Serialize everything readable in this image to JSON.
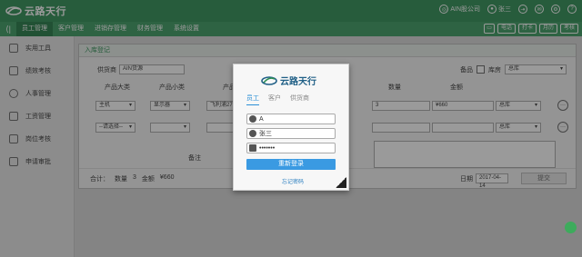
{
  "brand": {
    "name": "云路天行"
  },
  "topbar": {
    "company": "AIN股公司",
    "user": "张三"
  },
  "nav": {
    "collapse_glyph": "⟨|",
    "tabs": [
      "员工管理",
      "客户管理",
      "进销存管理",
      "财务管理",
      "系统设置"
    ],
    "tools": [
      "电话",
      "打卡",
      "月历",
      "考核"
    ]
  },
  "sidebar": {
    "items": [
      {
        "label": "实用工具"
      },
      {
        "label": "绩效考核"
      },
      {
        "label": "人事管理"
      },
      {
        "label": "工资管理"
      },
      {
        "label": "岗位考核"
      },
      {
        "label": "申请审批"
      }
    ]
  },
  "panel": {
    "title": "入库登记",
    "supplier_label": "供货商",
    "supplier_value": "AIN货源",
    "spare_label": "备品",
    "warehouse_label": "库房",
    "warehouse_value": "总库",
    "columns": [
      "产品大类",
      "产品小类",
      "产品",
      "数量",
      "金额"
    ],
    "rows": [
      {
        "category": "主机",
        "subcategory": "显示器",
        "product": "飞利浦27",
        "qty": "3",
        "amount": "¥660",
        "warehouse": "总库"
      },
      {
        "category": "--请选择--",
        "subcategory": "",
        "product": "",
        "qty": "",
        "amount": "",
        "warehouse": "总库"
      }
    ],
    "remark_label": "备注",
    "sum_label": "合计：",
    "qty_label": "数量",
    "qty_total": "3",
    "amount_label": "金额",
    "amount_total": "¥660",
    "date_label": "日期",
    "date_value": "2017-04-14",
    "submit_label": "提交"
  },
  "login": {
    "tabs": [
      "员工",
      "客户",
      "供货商"
    ],
    "company_value": "A",
    "user_value": "张三",
    "password_mask": "•••••••",
    "submit_label": "重新登录",
    "forgot_label": "忘记密码"
  }
}
